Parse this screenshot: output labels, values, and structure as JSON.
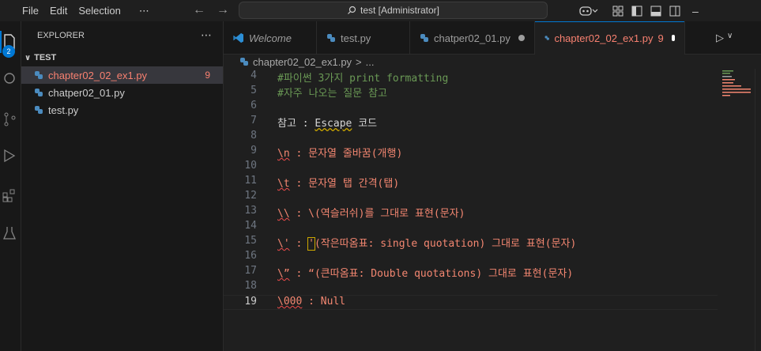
{
  "menu": {
    "file": "File",
    "edit": "Edit",
    "selection": "Selection",
    "more": "⋯"
  },
  "search": {
    "text": "test [Administrator]"
  },
  "activity": {
    "badge": "2"
  },
  "sidebar": {
    "title": "EXPLORER",
    "more": "⋯",
    "folder": "TEST",
    "files": [
      {
        "name": "chapter02_02_ex1.py",
        "count": "9"
      },
      {
        "name": "chatper02_01.py"
      },
      {
        "name": "test.py"
      }
    ]
  },
  "tabs": [
    {
      "label": "Welcome"
    },
    {
      "label": "test.py"
    },
    {
      "label": "chatper02_01.py"
    },
    {
      "label": "chapter02_02_ex1.py",
      "count": "9"
    }
  ],
  "breadcrumb": {
    "file": "chapter02_02_ex1.py",
    "sep": ">",
    "more": "..."
  },
  "code": {
    "lines": [
      {
        "n": "4",
        "text": "#파이썬 3가지 print formatting"
      },
      {
        "n": "5",
        "text": "#자주 나오는 질문 참고"
      },
      {
        "n": "6",
        "text": ""
      },
      {
        "n": "7",
        "a": "참고 : ",
        "b": "Escape",
        "c": " 코드"
      },
      {
        "n": "8",
        "text": ""
      },
      {
        "n": "9",
        "a": "\\n",
        "b": " : 문자열 줄바꿈(개행)"
      },
      {
        "n": "10",
        "text": ""
      },
      {
        "n": "11",
        "a": "\\t",
        "b": " : 문자열 탭 간격(탭)"
      },
      {
        "n": "12",
        "text": ""
      },
      {
        "n": "13",
        "a": "\\\\",
        "b": " : \\(역슬러쉬)를 그대로 표현(문자)"
      },
      {
        "n": "14",
        "text": ""
      },
      {
        "n": "15",
        "a": "\\'",
        "b": " : ",
        "c": "'",
        "d": "(작은따옴표: single quotation) 그대로 표현(문자)"
      },
      {
        "n": "16",
        "text": ""
      },
      {
        "n": "17",
        "a": "\\”",
        "b": " : “(큰따옴표: Double quotations) 그대로 표현(문자)"
      },
      {
        "n": "18",
        "text": ""
      },
      {
        "n": "19",
        "a": "\\000",
        "b": " : Null"
      }
    ]
  },
  "colors": {
    "accent": "#0078d4",
    "error": "#f88070",
    "comment": "#6a9955"
  },
  "icons": [
    "vscode-logo-icon",
    "search-icon",
    "copilot-icon",
    "layout-icon",
    "explorer-icon",
    "source-control-icon",
    "run-debug-icon",
    "extensions-icon",
    "testing-icon",
    "python-file-icon",
    "run-icon"
  ]
}
